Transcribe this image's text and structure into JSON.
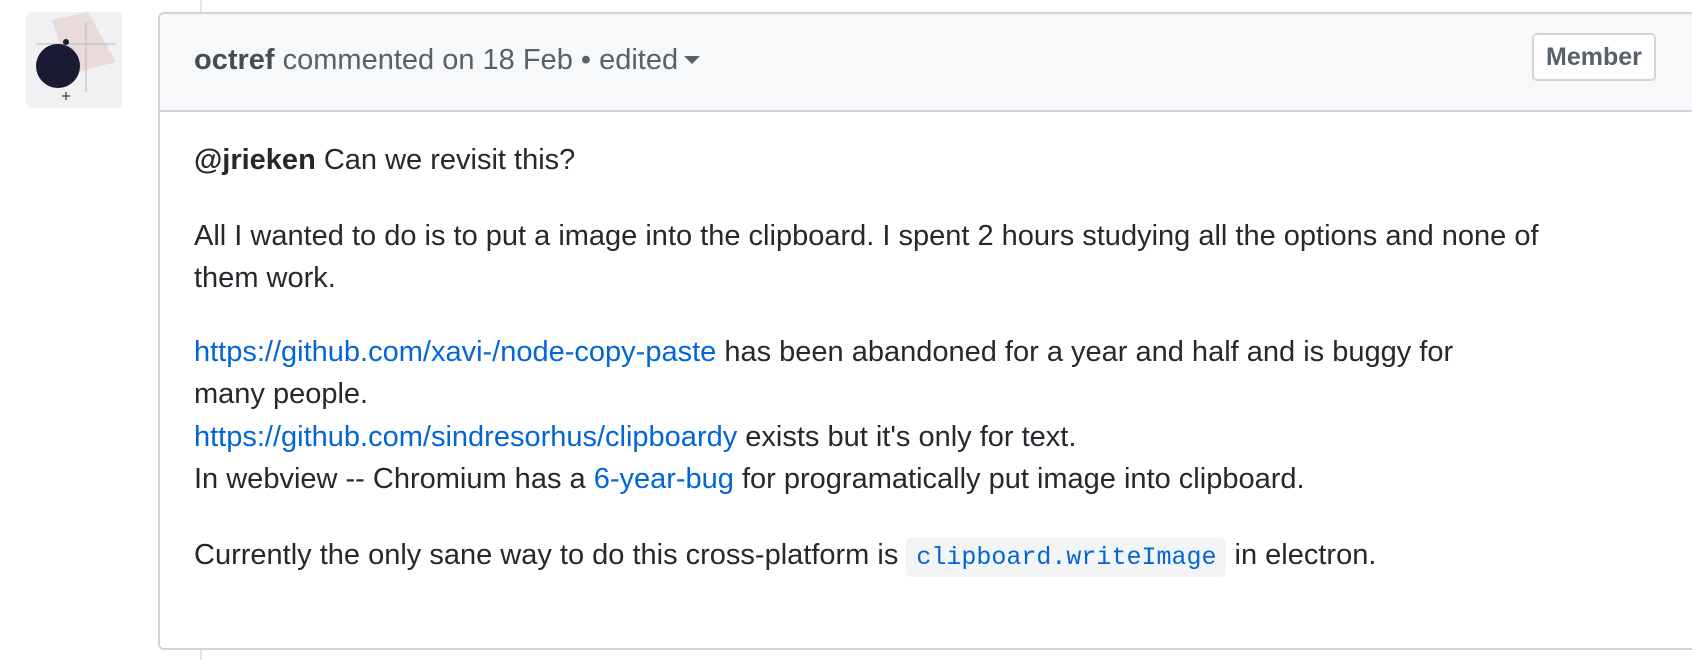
{
  "avatar": {
    "alt": "octref avatar"
  },
  "comment": {
    "author": "octref",
    "action": "commented on",
    "date": "18 Feb",
    "separator": "•",
    "edited_label": "edited",
    "badge": "Member"
  },
  "body": {
    "p1": {
      "mention": "@jrieken",
      "text": " Can we revisit this?"
    },
    "p2": {
      "line1": "All I wanted to do is to put a image into the clipboard. I spent 2 hours studying all the options and none of",
      "line2": "them work."
    },
    "p3": {
      "link1": "https://github.com/xavi-/node-copy-paste",
      "text1": " has been abandoned for a year and half and is buggy for",
      "text1_cont": "many people.",
      "link2": "https://github.com/sindresorhus/clipboardy",
      "text2": " exists but it's only for text.",
      "text3_pre": "In webview -- Chromium has a ",
      "link3": "6-year-bug",
      "text3_post": " for programatically put image into clipboard."
    },
    "p4": {
      "pre": "Currently the only sane way to do this cross-platform is ",
      "code": "clipboard.writeImage",
      "post": " in electron."
    }
  }
}
